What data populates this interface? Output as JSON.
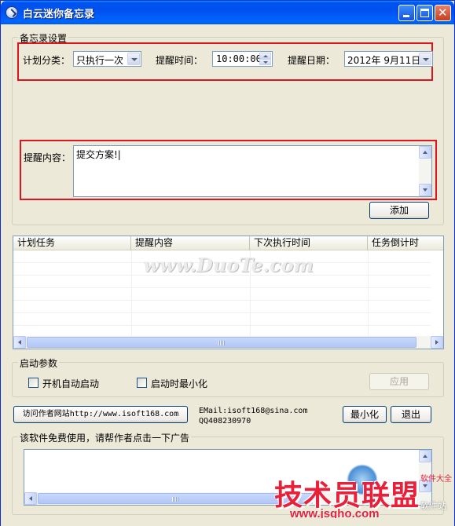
{
  "window": {
    "title": "白云迷你备忘录"
  },
  "settings": {
    "group_title": "备忘录设置",
    "category_label": "计划分类：",
    "category_value": "只执行一次",
    "time_label": "提醒时间：",
    "time_value": "10:00:00",
    "date_label": "提醒日期：",
    "date_value": "2012年  9月11日",
    "content_label": "提醒内容：",
    "content_value": "提交方案!|",
    "add_button": "添加"
  },
  "tasks": {
    "columns": [
      "计划任务",
      "提醒内容",
      "下次执行时间",
      "任务倒计时"
    ],
    "rows": []
  },
  "watermark": "www.DuoTe.com",
  "startup": {
    "group_title": "启动参数",
    "autostart_label": "开机自动启动",
    "autostart_checked": false,
    "minimize_label": "启动时最小化",
    "minimize_checked": false,
    "apply_button": "应用"
  },
  "author": {
    "visit_button": "访问作者网站http://www.isoft168.com",
    "email": "EMail:isoft168@sina.com",
    "qq": "QQ408230970",
    "minimize_button": "最小化",
    "exit_button": "退出"
  },
  "ad": {
    "group_title": "该软件免费使用，请帮作者点击一下广告",
    "logo_text": "技术员联盟",
    "logo_url": "www.jsgho.com",
    "logo_small": "软件大全",
    "logo_small2": "软件站"
  },
  "colors": {
    "titlebar": "#0054e3",
    "highlight_box": "#e0141e",
    "face": "#ece9d8"
  }
}
